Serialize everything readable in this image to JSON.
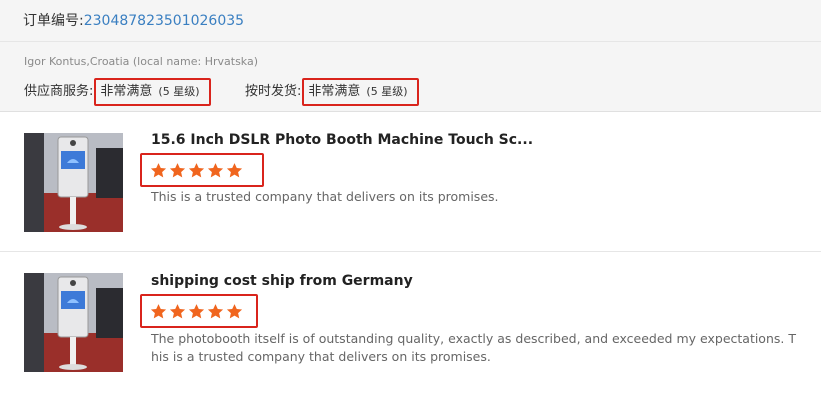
{
  "order": {
    "label": "订单编号:",
    "number": "230487823501026035"
  },
  "buyer": {
    "text": "Igor Kontus,Croatia (local name: Hrvatska)"
  },
  "ratings": {
    "supplier_label": "供应商服务:",
    "supplier_value": "非常满意",
    "supplier_grade": "(5 星级)",
    "shipping_label": "按时发货:",
    "shipping_value": "非常满意",
    "shipping_grade": "(5 星级)"
  },
  "reviews": [
    {
      "title": "15.6 Inch DSLR Photo Booth Machine Touch Sc...",
      "stars": 5,
      "text": "This is a trusted company that delivers on its promises."
    },
    {
      "title": "shipping cost ship from Germany",
      "stars": 5,
      "text": "The photobooth itself is of outstanding quality, exactly as described, and exceeded my expectations. This is a trusted company that delivers on its promises."
    }
  ],
  "colors": {
    "link": "#3a7fc1",
    "star": "#f0651e",
    "highlight_box": "#d9241c"
  }
}
